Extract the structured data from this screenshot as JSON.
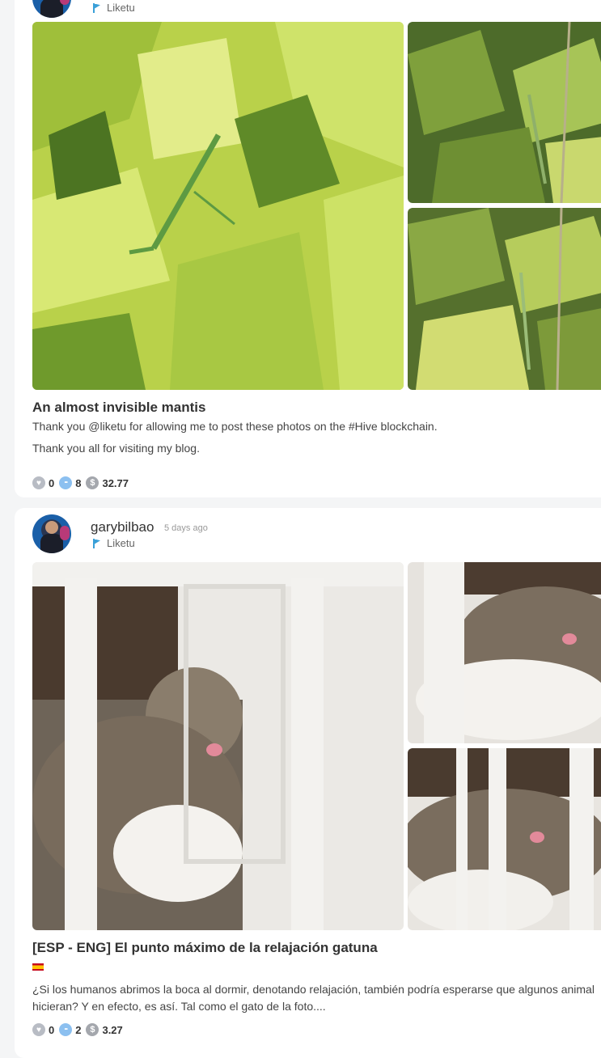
{
  "posts": [
    {
      "author": "",
      "time_ago": "",
      "community": "Liketu",
      "title": "An almost invisible mantis",
      "paragraphs": [
        "Thank you @liketu for allowing me to post these photos on the #Hive blockchain.",
        "Thank you all for visiting my blog."
      ],
      "stats": {
        "likes": "0",
        "comments": "8",
        "payout": "32.77"
      },
      "colors": {
        "leaf_light": "#c8e05a",
        "leaf_dark": "#3f5a1f"
      }
    },
    {
      "author": "garybilbao",
      "time_ago": "5 days ago",
      "community": "Liketu",
      "title": "[ESP - ENG] El punto máximo de la relajación gatuna",
      "paragraphs": [
        "¿Si los humanos abrimos la boca al dormir, denotando relajación, también podría esperarse que algunos animal hicieran? Y en efecto, es así. Tal como el gato de la foto...."
      ],
      "stats": {
        "likes": "0",
        "comments": "2",
        "payout": "3.27"
      },
      "colors": {
        "wall": "#e8e6e2",
        "cat": "#7a6e60"
      }
    }
  ],
  "icons": {
    "like": "heart-icon",
    "comment": "comment-icon",
    "payout": "dollar-icon",
    "community": "liketu-flag-icon",
    "language": "spain-flag-icon"
  }
}
